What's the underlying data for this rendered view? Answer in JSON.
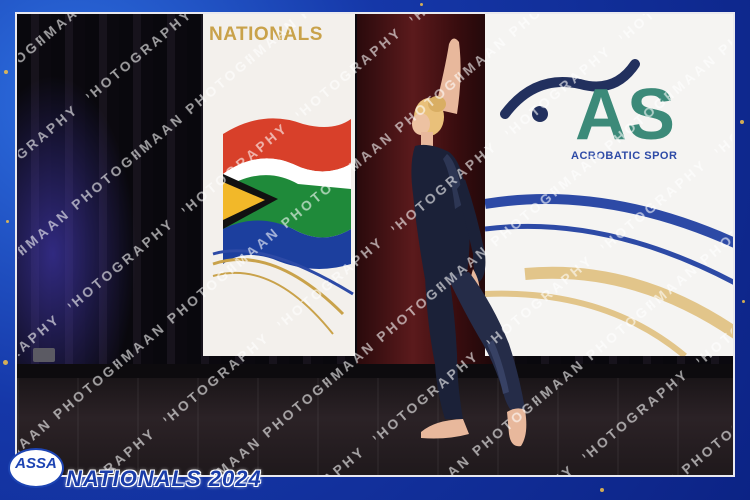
{
  "banners": {
    "left_title": "NATIONALS",
    "right_logo": "ASSA",
    "right_subtitle": "ACROBATIC SPOR"
  },
  "footer": {
    "logo_text": "ASSA",
    "event_title": "NATIONALS 2024"
  },
  "watermark": {
    "text": "IMAAN PHOTOGRAPHY"
  },
  "colors": {
    "frame_blue": "#1537a8",
    "gold_accent": "#f3c24a",
    "banner_gold": "#c9a24a",
    "brand_blue": "#1d44b3"
  }
}
